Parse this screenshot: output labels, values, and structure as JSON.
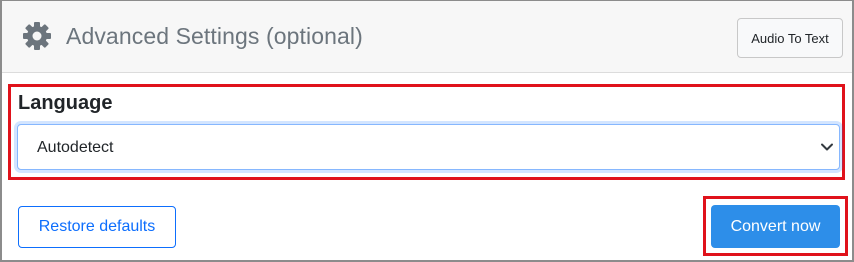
{
  "header": {
    "icon": "gear-icon",
    "title": "Advanced Settings (optional)",
    "audio_to_text_label": "Audio To Text"
  },
  "language": {
    "label": "Language",
    "selected": "Autodetect",
    "dropdown_icon": "chevron-down-icon"
  },
  "actions": {
    "restore_label": "Restore defaults",
    "convert_label": "Convert now"
  },
  "colors": {
    "highlight_red": "#e0121b",
    "primary_blue": "#0d6efd",
    "convert_blue": "#2d8ee9",
    "muted_text": "#6c757d"
  }
}
